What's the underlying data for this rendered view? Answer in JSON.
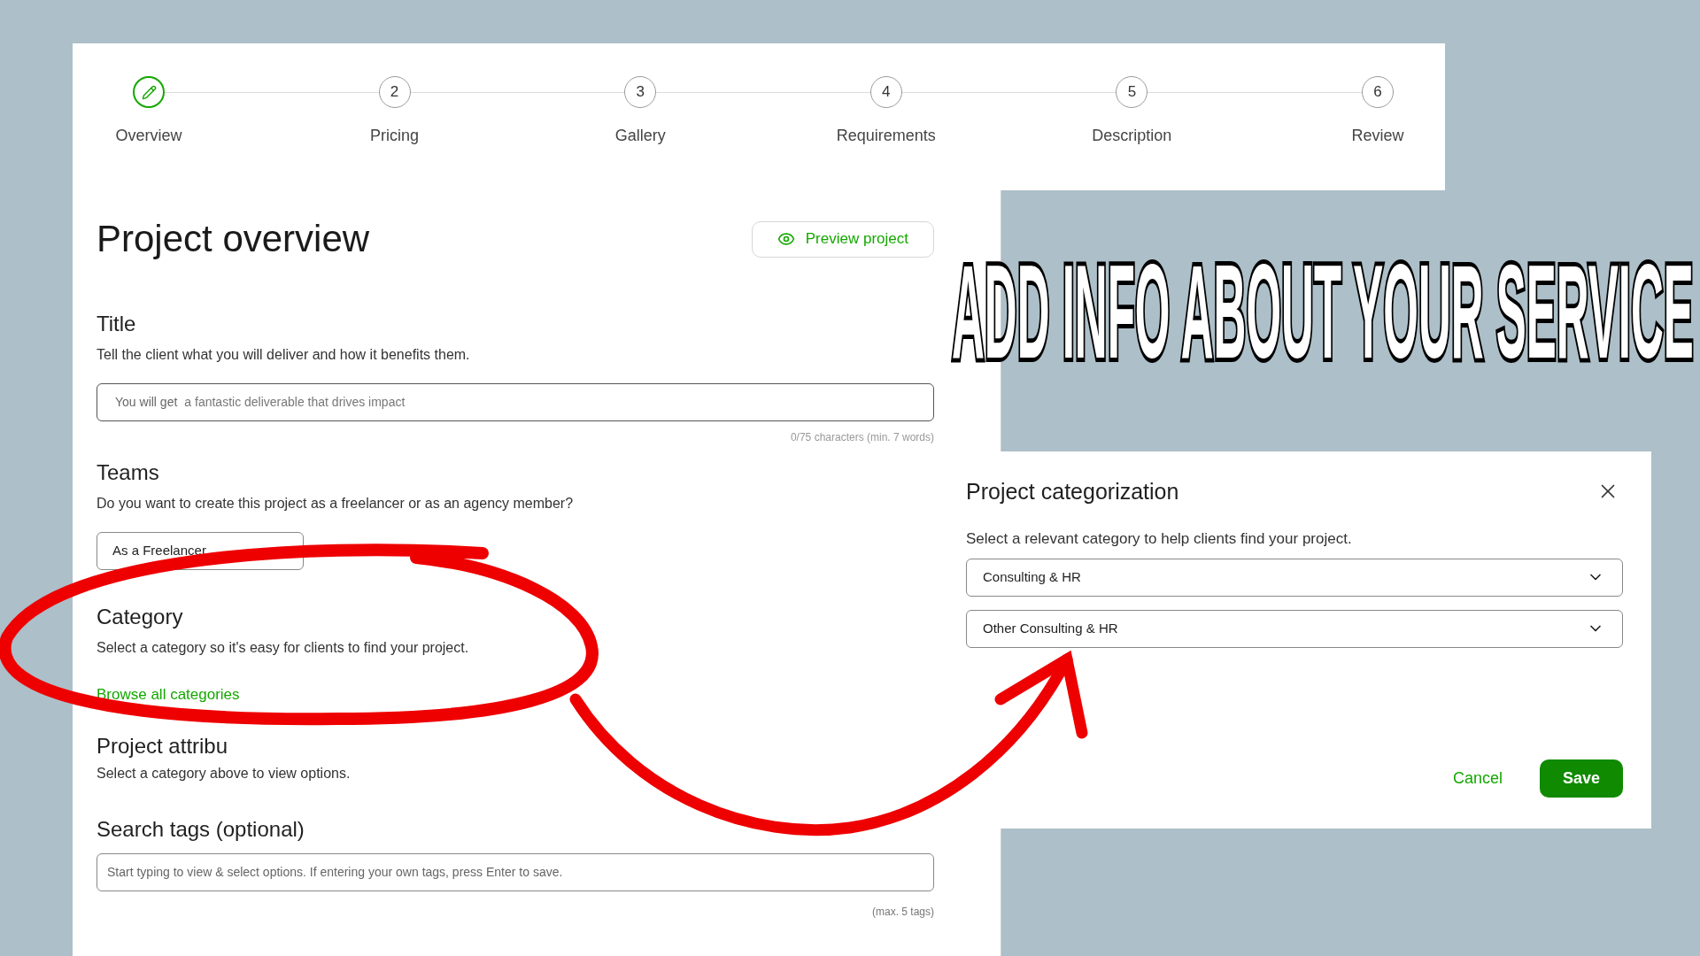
{
  "steps": [
    {
      "label": "Overview",
      "selected": true
    },
    {
      "number": "2",
      "label": "Pricing",
      "selected": false
    },
    {
      "number": "3",
      "label": "Gallery",
      "selected": false
    },
    {
      "number": "4",
      "label": "Requirements",
      "selected": false
    },
    {
      "number": "5",
      "label": "Description",
      "selected": false
    },
    {
      "number": "6",
      "label": "Review",
      "selected": false
    }
  ],
  "overview": {
    "heading": "Project overview",
    "preview_button": "Preview project",
    "title": {
      "heading": "Title",
      "description": "Tell the client what you will deliver and how it benefits them.",
      "prefix": "You will get",
      "placeholder": "a fantastic deliverable that drives impact",
      "counter": "0/75 characters (min. 7 words)"
    },
    "teams": {
      "heading": "Teams",
      "description": "Do you want to create this project as a freelancer or as an agency member?",
      "value": "As a Freelancer"
    },
    "category": {
      "heading": "Category",
      "description": "Select a category so it's easy for clients to find your project.",
      "link": "Browse all categories"
    },
    "attributes": {
      "heading": "Project attribu",
      "description": "Select a category above to view options."
    },
    "tags": {
      "heading": "Search tags (optional)",
      "placeholder": "Start typing to view & select options. If entering your own tags, press Enter to save.",
      "note": "(max. 5 tags)"
    }
  },
  "banner": {
    "text": "ADD INFO ABOUT YOUR SERVICE"
  },
  "dialog": {
    "title": "Project categorization",
    "description": "Select a relevant category to help clients find your project.",
    "selects": [
      {
        "value": "Consulting & HR"
      },
      {
        "value": "Other Consulting & HR"
      }
    ],
    "cancel": "Cancel",
    "save": "Save"
  }
}
